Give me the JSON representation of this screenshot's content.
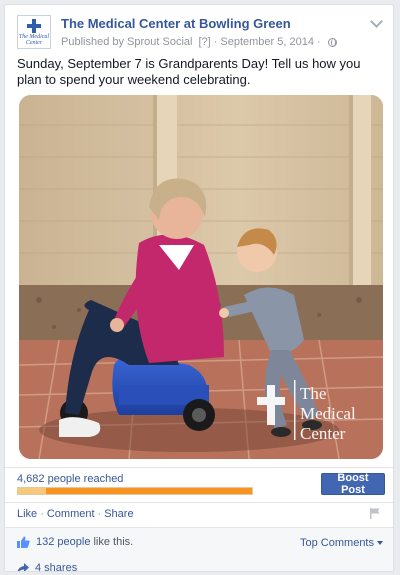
{
  "post": {
    "page_name": "The Medical Center at Bowling Green",
    "published_by": "Published by Sprout Social",
    "help_marker": "[?]",
    "date": "September 5, 2014",
    "text": "Sunday, September 7 is Grandparents Day! Tell us how you plan to spend your weekend celebrating.",
    "avatar_text": "The Medical Center"
  },
  "photo": {
    "watermark_lines": [
      "The",
      "Medical",
      "Center"
    ]
  },
  "insights": {
    "reach_text": "4,682 people reached",
    "organic_fraction": 0.12,
    "boost_label": "Boost Post"
  },
  "actions": {
    "like": "Like",
    "comment": "Comment",
    "share": "Share"
  },
  "social": {
    "likes_count_link": "132 people",
    "likes_suffix": "like this.",
    "top_comments": "Top Comments",
    "shares": "4 shares"
  },
  "colors": {
    "link": "#365899",
    "boost": "#4267b2",
    "reach_paid": "#f7931e",
    "reach_organic": "#f7c97a"
  },
  "icons": [
    "globe-icon",
    "chevron-down-icon",
    "flag-icon",
    "thumbs-up-icon",
    "share-icon"
  ]
}
